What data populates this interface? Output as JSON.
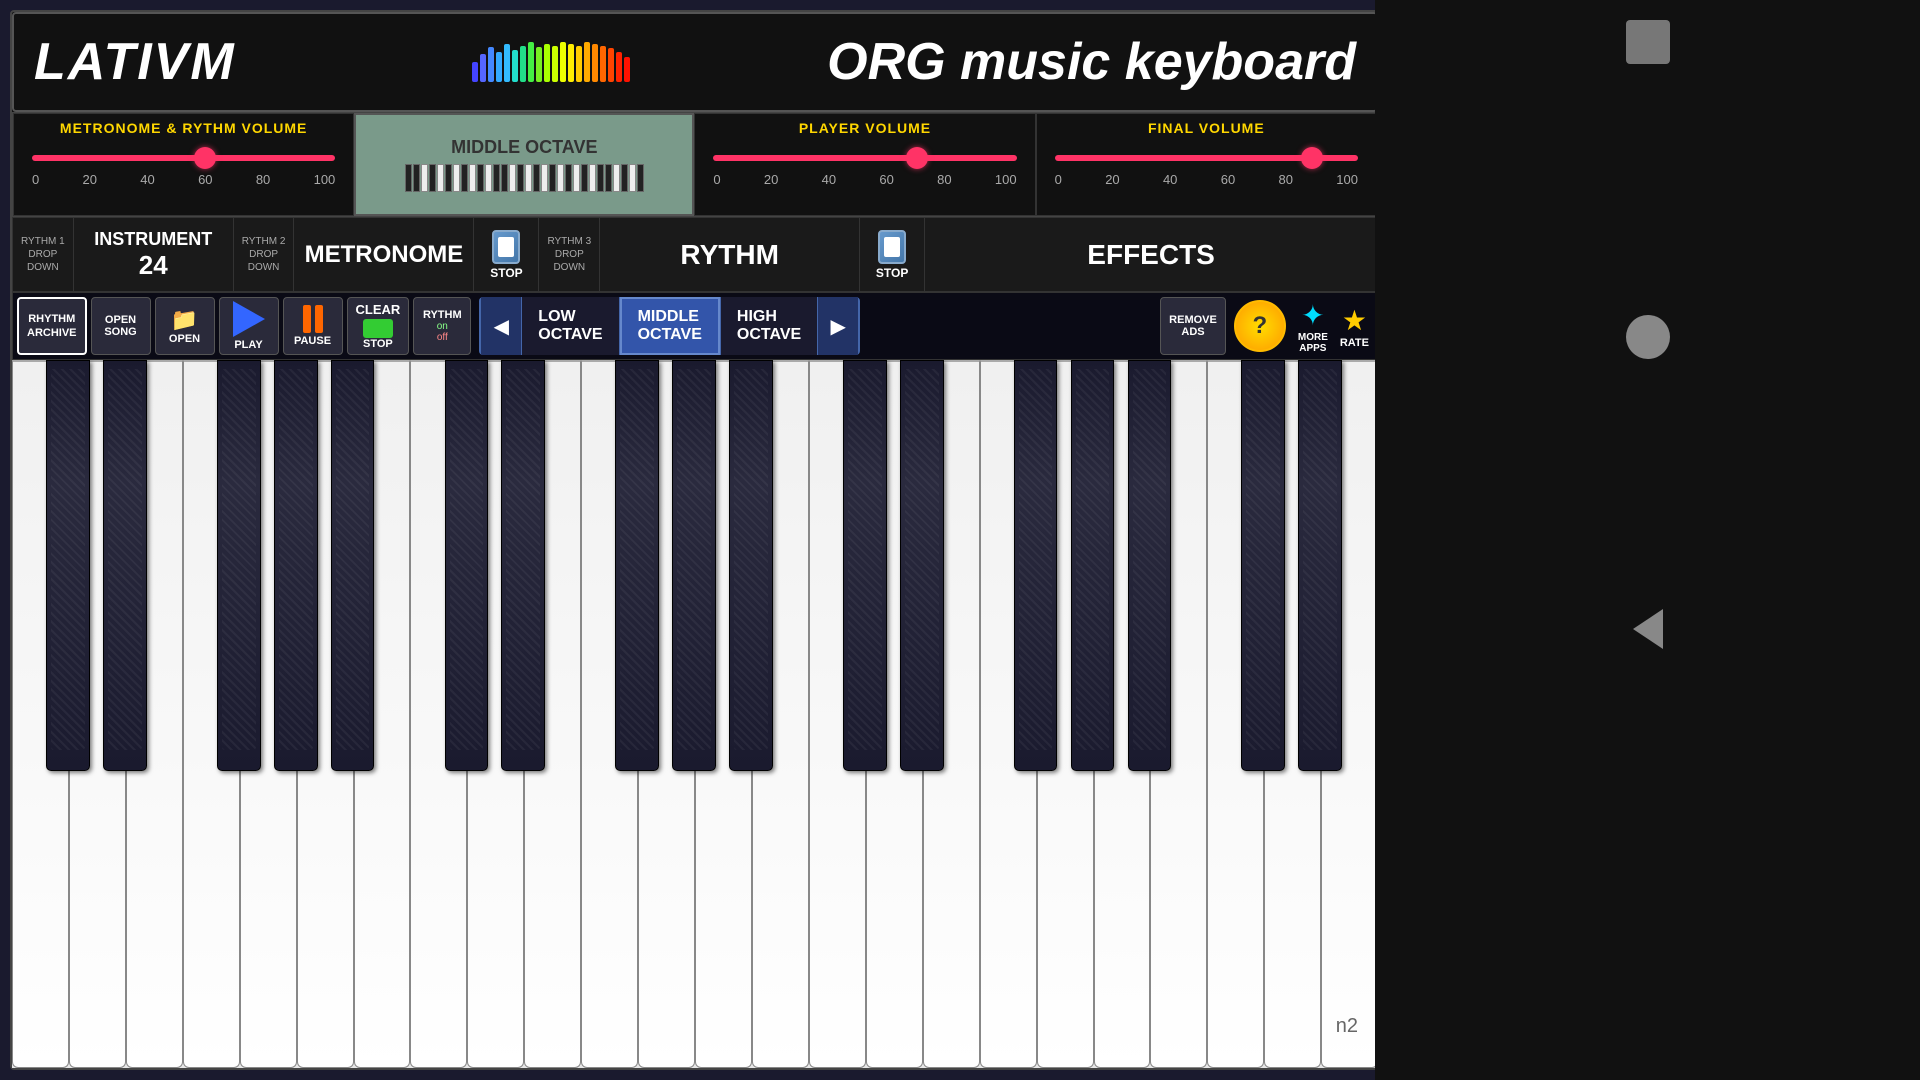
{
  "header": {
    "logo": "LATIVM",
    "title": "ORG music keyboard",
    "spectrum_colors": [
      "#4444ff",
      "#5555ff",
      "#6666ff",
      "#7777ff",
      "#3399ff",
      "#33bbff",
      "#33ddbb",
      "#33cc66",
      "#44dd44",
      "#66ee22",
      "#88ff00",
      "#aaff00",
      "#ccff00",
      "#eeff00",
      "#ffee00",
      "#ffcc00",
      "#ffaa00",
      "#ff8800",
      "#ff6600",
      "#ff4400",
      "#ff2200"
    ]
  },
  "volumes": {
    "metronome_rythm": {
      "title": "METRONOME & RYTHM  VOLUME",
      "value": 60,
      "labels": [
        "0",
        "20",
        "40",
        "60",
        "80",
        "100"
      ],
      "thumb_pct": 57
    },
    "octave_display": {
      "label": "MIDDLE OCTAVE"
    },
    "player": {
      "title": "PLAYER VOLUME",
      "value": 70,
      "labels": [
        "0",
        "20",
        "40",
        "60",
        "80",
        "100"
      ],
      "thumb_pct": 67
    },
    "final": {
      "title": "FINAL VOLUME",
      "value": 85,
      "labels": [
        "0",
        "20",
        "40",
        "60",
        "80",
        "100"
      ],
      "thumb_pct": 85
    }
  },
  "controls": {
    "rythm1": {
      "line1": "RYTHM 1",
      "line2": "DROP",
      "line3": "DOWN"
    },
    "instrument": {
      "label": "INSTRUMENT",
      "value": "24"
    },
    "rythm2": {
      "line1": "RYTHM 2",
      "line2": "DROP",
      "line3": "DOWN"
    },
    "metronome": "METRONOME",
    "rythm3": {
      "line1": "RYTHM 3",
      "line2": "DROP",
      "line3": "DOWN"
    },
    "rythm": "RYTHM",
    "effects": "EFFECTS",
    "stop": "STOP"
  },
  "toolbar": {
    "rhythm_archive": "RHYTHM\nARCHIVE",
    "open_song": "OPEN\nSONG",
    "open": "OPEN",
    "play": "PLAY",
    "pause": "PAUSE",
    "clear": "CLEAR",
    "stop": "STOP",
    "rythm_on": "RYTHM",
    "rythm_off": "on\noff",
    "octaves": {
      "low": "LOW\nOCTAVE",
      "middle": "MIDDLE\nOCTAVE",
      "high": "HIGH\nOCTAVE",
      "active": "middle"
    },
    "remove_ads": "REMOVE\nADS",
    "help": "?",
    "more_apps": "MORE\nAPPS",
    "rate": "RATE"
  },
  "piano": {
    "white_keys": 24,
    "n2_label": "n2"
  }
}
